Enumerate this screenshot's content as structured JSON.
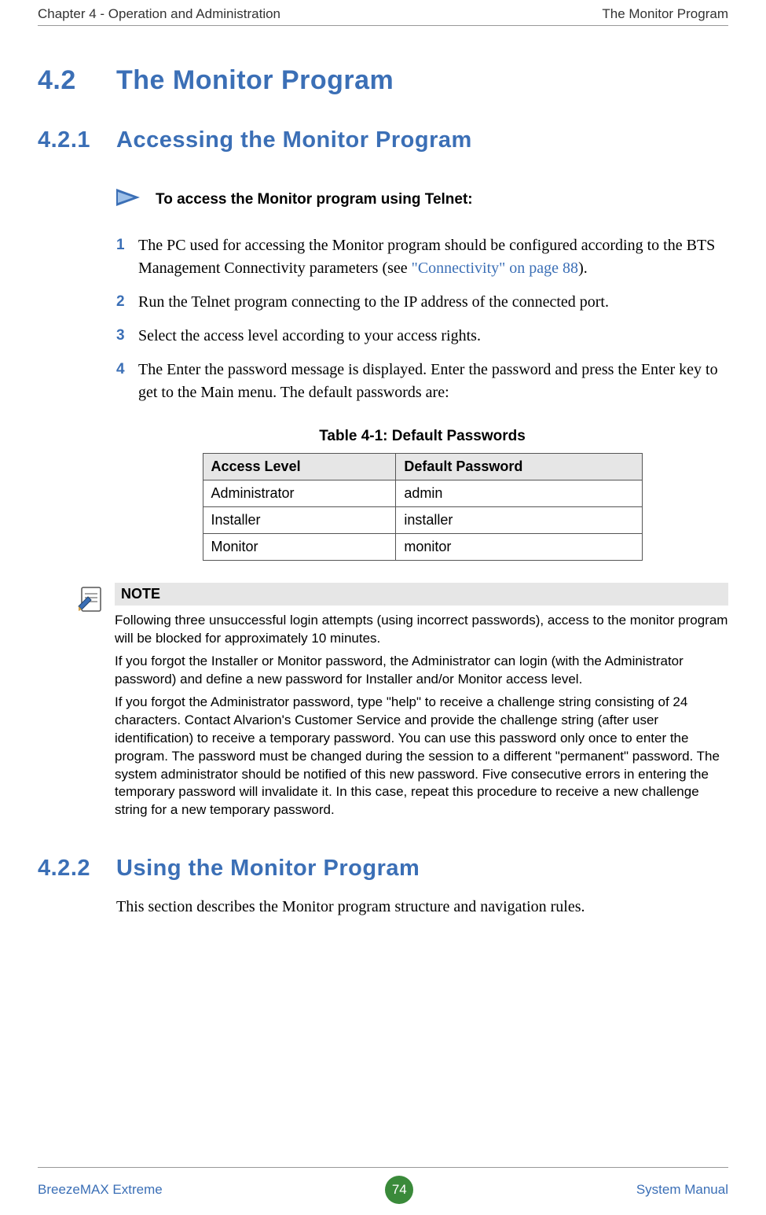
{
  "header": {
    "left": "Chapter 4 - Operation and Administration",
    "right": "The Monitor Program"
  },
  "h1": {
    "num": "4.2",
    "title": "The Monitor Program"
  },
  "h2a": {
    "num": "4.2.1",
    "title": "Accessing the Monitor Program"
  },
  "arrow_label": "To access the Monitor program using Telnet:",
  "steps": {
    "s1_a": "The PC used for accessing the Monitor program should be configured according to the BTS Management Connectivity parameters (see ",
    "s1_link": "\"Connectivity\" on page 88",
    "s1_b": ").",
    "s2": "Run the Telnet program connecting to the IP address of the connected port.",
    "s3": "Select the access level according to your access rights.",
    "s4": "The Enter the password message  is displayed. Enter the password and press the Enter key to get to the Main menu. The default passwords are:"
  },
  "table": {
    "caption": "Table 4-1: Default Passwords",
    "head": {
      "c1": "Access Level",
      "c2": "Default Password"
    },
    "rows": [
      {
        "c1": "Administrator",
        "c2": "admin"
      },
      {
        "c1": "Installer",
        "c2": "installer"
      },
      {
        "c1": "Monitor",
        "c2": "monitor"
      }
    ]
  },
  "note": {
    "title": "NOTE",
    "p1": "Following three unsuccessful login attempts (using incorrect passwords), access to the monitor program will be blocked for approximately 10 minutes.",
    "p2": "If you forgot the Installer or Monitor password, the Administrator can login (with the Administrator password) and define a new password for Installer and/or Monitor access level.",
    "p3": "If you forgot the Administrator password, type \"help\" to receive a challenge string consisting of 24 characters. Contact Alvarion's Customer Service and provide the challenge string (after user identification) to receive a temporary password. You can use this password only once to enter the program. The password must be changed during the session to a different  \"permanent\" password. The system administrator should be notified of this new password. Five consecutive errors in entering the temporary password will invalidate it. In this case, repeat this procedure to receive a new challenge string for a new temporary password."
  },
  "h2b": {
    "num": "4.2.2",
    "title": "Using the Monitor Program"
  },
  "using_body": "This section describes the Monitor program structure and navigation rules.",
  "footer": {
    "left": "BreezeMAX Extreme",
    "page": "74",
    "right": "System Manual"
  },
  "nums": {
    "n1": "1",
    "n2": "2",
    "n3": "3",
    "n4": "4"
  }
}
